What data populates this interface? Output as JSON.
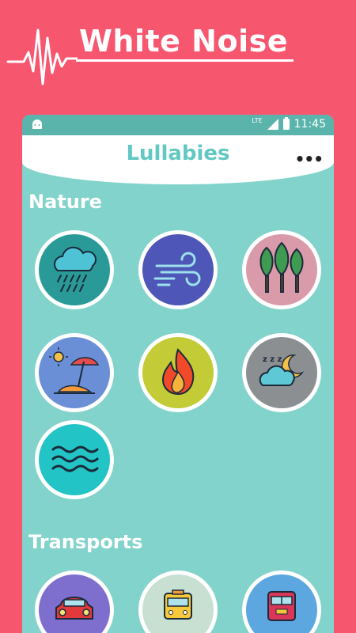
{
  "promo": {
    "title": "White Noise"
  },
  "status_bar": {
    "network": "LTE",
    "time": "11:45"
  },
  "app_bar": {
    "title": "Lullabies",
    "menu_label": "•••"
  },
  "sections": [
    {
      "title": "Nature",
      "items": [
        {
          "icon": "rain-cloud-icon",
          "color": "#2a9a98"
        },
        {
          "icon": "wind-icon",
          "color": "#4e56b8"
        },
        {
          "icon": "forest-icon",
          "color": "#d99aaa"
        },
        {
          "icon": "beach-icon",
          "color": "#6a8fd6"
        },
        {
          "icon": "fire-icon",
          "color": "#c3cb36"
        },
        {
          "icon": "night-cloud-icon",
          "color": "#8b8f92"
        },
        {
          "icon": "waves-icon",
          "color": "#23c4c6"
        }
      ]
    },
    {
      "title": "Transports",
      "items": [
        {
          "icon": "car-icon",
          "color": "#7e6fcf"
        },
        {
          "icon": "bus-icon",
          "color": "#c7e0d2"
        },
        {
          "icon": "train-icon",
          "color": "#5ca7e0"
        }
      ]
    }
  ]
}
